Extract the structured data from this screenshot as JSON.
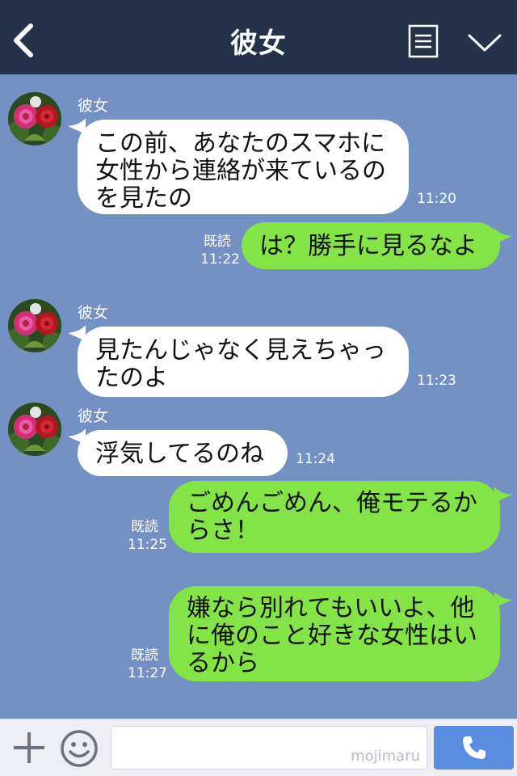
{
  "header": {
    "title": "彼女",
    "bg_color": "#263249"
  },
  "chat": {
    "bg_color": "#7391c2",
    "messages": [
      {
        "side": "in",
        "sender": "彼女",
        "lines": [
          "この前、あなたのスマホに",
          "女性から連絡が来ているの",
          "を見たの"
        ],
        "time": "11:20"
      },
      {
        "side": "out",
        "lines": [
          "は？勝手に見るなよ"
        ],
        "read": "既読",
        "time": "11:22"
      },
      {
        "side": "in",
        "sender": "彼女",
        "lines": [
          "見たんじゃなく見えちゃっ",
          "たのよ"
        ],
        "time": "11:23"
      },
      {
        "side": "in",
        "sender": "彼女",
        "lines": [
          "浮気してるのね"
        ],
        "time": "11:24"
      },
      {
        "side": "out",
        "lines": [
          "ごめんごめん、俺モテるか",
          "らさ！"
        ],
        "read": "既読",
        "time": "11:25"
      },
      {
        "side": "out",
        "lines": [
          "嫌なら別れてもいいよ、他",
          "に俺のこと好きな女性はい",
          "るから"
        ],
        "read": "既読",
        "time": "11:27"
      }
    ]
  },
  "footer": {
    "input_value": "",
    "watermark": "mojimaru"
  },
  "icons": {
    "back": "chevron-left-icon",
    "menu": "list-icon",
    "more": "chevron-down-icon",
    "plus": "plus-icon",
    "emoji": "smiley-icon",
    "call": "phone-icon"
  },
  "colors": {
    "incoming_bubble": "#ffffff",
    "outgoing_bubble": "#84e347",
    "call_button": "#5a8de0"
  }
}
